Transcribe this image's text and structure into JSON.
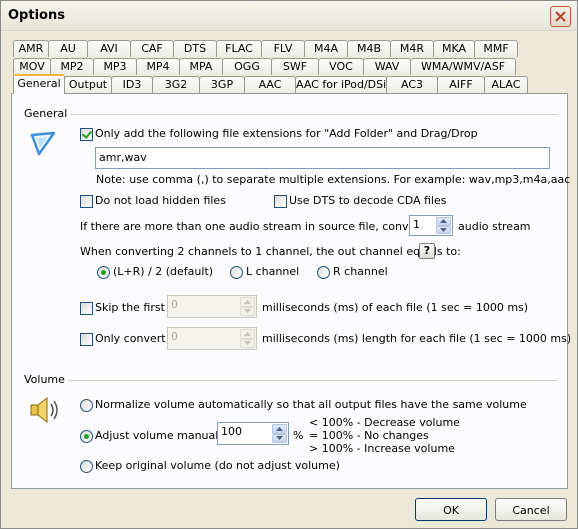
{
  "window": {
    "title": "Options"
  },
  "tabs": {
    "row1": [
      "AMR",
      "AU",
      "AVI",
      "CAF",
      "DTS",
      "FLAC",
      "FLV",
      "M4A",
      "M4B",
      "M4R",
      "MKA",
      "MMF"
    ],
    "row2": [
      "MOV",
      "MP2",
      "MP3",
      "MP4",
      "MPA",
      "OGG",
      "SWF",
      "VOC",
      "WAV",
      "WMA/WMV/ASF"
    ],
    "row3": [
      "General",
      "Output",
      "ID3",
      "3G2",
      "3GP",
      "AAC",
      "AAC for iPod/DSi",
      "AC3",
      "AIFF",
      "ALAC"
    ],
    "active": "General"
  },
  "general": {
    "group_label": "General",
    "only_add_label": "Only add the following file extensions for \"Add Folder\" and Drag/Drop",
    "only_add_checked": true,
    "extensions_value": "amr,wav",
    "note": "Note: use comma (,) to separate multiple extensions. For example: wav,mp3,m4a,aac",
    "no_hidden_label": "Do not load hidden files",
    "no_hidden_checked": false,
    "use_dts_label": "Use DTS to decode CDA files",
    "use_dts_checked": false,
    "multi_stream_label": "If there are more than one audio stream in source file, converts no.",
    "stream_no": "1",
    "audio_stream_label": "audio stream",
    "channel_label": "When converting 2 channels to 1 channel, the out channel equals to:",
    "help_label": "?",
    "channel_options": [
      "(L+R) / 2 (default)",
      "L channel",
      "R channel"
    ],
    "channel_selected": 0,
    "skip_first_label": "Skip the first",
    "skip_first_value": "0",
    "skip_first_unit": "milliseconds (ms) of each file (1 sec = 1000 ms)",
    "only_convert_label": "Only convert",
    "only_convert_value": "0",
    "only_convert_unit": "milliseconds (ms) length for each file (1 sec = 1000 ms)"
  },
  "volume": {
    "group_label": "Volume",
    "normalize_label": "Normalize volume automatically so that all output files have the same volume",
    "adjust_label": "Adjust volume manually",
    "adjust_value": "100",
    "percent": "%",
    "keep_label": "Keep original volume (do not adjust volume)",
    "selected": 1,
    "legend": [
      "< 100% - Decrease volume",
      "= 100% - No changes",
      "> 100% - Increase volume"
    ]
  },
  "buttons": {
    "ok": "OK",
    "cancel": "Cancel"
  }
}
